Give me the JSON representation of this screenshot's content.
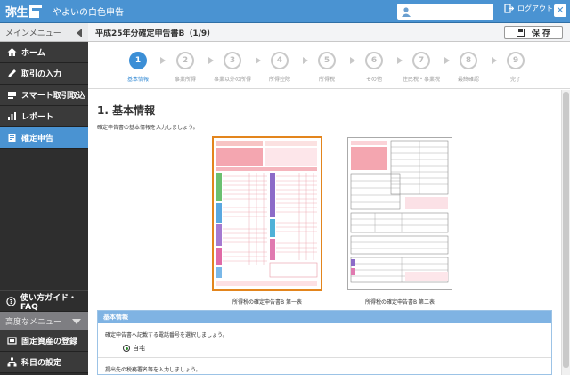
{
  "header": {
    "logo": "弥生",
    "app_name": "やよいの白色申告",
    "logout_label": "ログアウト"
  },
  "sidebar": {
    "menu_title": "メインメニュー",
    "items": [
      {
        "label": "ホーム",
        "icon": "home-icon"
      },
      {
        "label": "取引の入力",
        "icon": "pencil-icon"
      },
      {
        "label": "スマート取引取込",
        "icon": "import-icon"
      },
      {
        "label": "レポート",
        "icon": "chart-icon"
      },
      {
        "label": "確定申告",
        "icon": "document-icon"
      }
    ],
    "active_index": 4,
    "guide_label": "使い方ガイド・FAQ",
    "advanced_title": "高度なメニュー",
    "advanced_items": [
      {
        "label": "固定資産の登録",
        "icon": "asset-icon"
      },
      {
        "label": "科目の設定",
        "icon": "tree-icon"
      }
    ]
  },
  "main": {
    "title": "平成25年分確定申告書B（1/9）",
    "save_label": "保 存",
    "steps": [
      {
        "num": "1",
        "label": "基本情報",
        "active": true
      },
      {
        "num": "2",
        "label": "事業所得",
        "active": false
      },
      {
        "num": "3",
        "label": "事業以外の所得",
        "active": false
      },
      {
        "num": "4",
        "label": "所得控除",
        "active": false
      },
      {
        "num": "5",
        "label": "所得税",
        "active": false
      },
      {
        "num": "6",
        "label": "その他",
        "active": false
      },
      {
        "num": "7",
        "label": "住民税・事業税",
        "active": false
      },
      {
        "num": "8",
        "label": "最終確認",
        "active": false
      },
      {
        "num": "9",
        "label": "完了",
        "active": false
      }
    ],
    "section_title": "1.  基本情報",
    "intro": "確定申告書の基本情報を入力しましょう。",
    "form1_caption": "所得税の確定申告書B 第一表",
    "form2_caption": "所得税の確定申告書B 第二表",
    "panel": {
      "title": "基本情報",
      "phone_text": "確定申告書へ記載する電話番号を選択しましょう。",
      "radio_label": "自宅",
      "tax_office_text": "提出先の税務署名等を入力しましょう。"
    }
  },
  "colors": {
    "accent": "#4a93d2",
    "form_highlight": "#e3851d",
    "sidebar_bg": "#2e2e2e"
  }
}
